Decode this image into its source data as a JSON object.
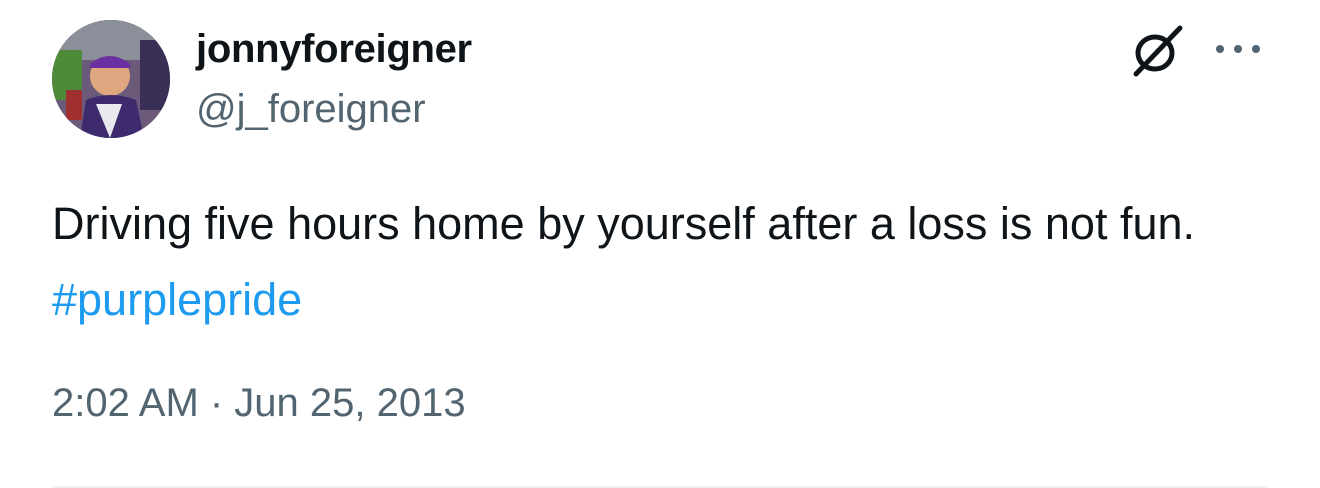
{
  "tweet": {
    "author": {
      "display_name": "jonnyforeigner",
      "handle": "@j_foreigner",
      "avatar_icon": "user-avatar-photo"
    },
    "text_before_hashtag": "Driving five hours home by yourself after a loss is not fun. ",
    "hashtag": "#purplepride",
    "timestamp": "2:02 AM · Jun 25, 2013"
  },
  "icons": {
    "platform": "slashed-circle-logo-icon",
    "more": "more-options-icon"
  },
  "colors": {
    "text": "#0f1419",
    "secondary_text": "#536471",
    "hashtag": "#1d9bf0",
    "divider": "#eff3f4"
  }
}
